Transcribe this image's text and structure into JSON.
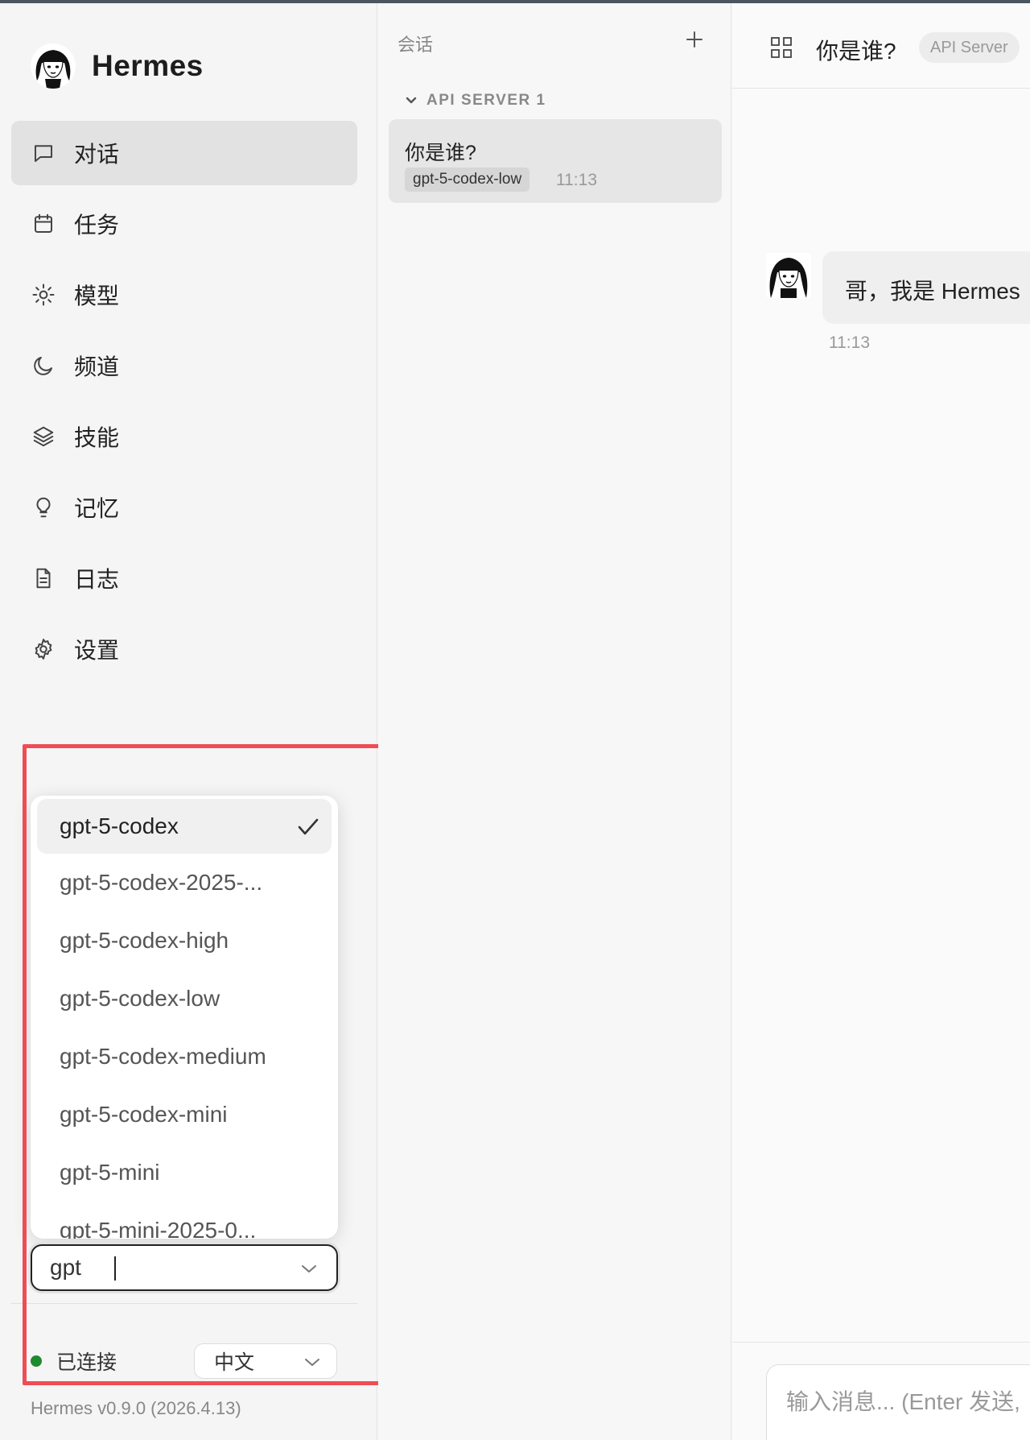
{
  "app": {
    "name": "Hermes",
    "version": "Hermes v0.9.0 (2026.4.13)"
  },
  "sidebar": {
    "items": [
      {
        "label": "对话",
        "icon": "chat-icon",
        "active": true
      },
      {
        "label": "任务",
        "icon": "calendar-icon",
        "active": false
      },
      {
        "label": "模型",
        "icon": "sun-icon",
        "active": false
      },
      {
        "label": "频道",
        "icon": "moon-icon",
        "active": false
      },
      {
        "label": "技能",
        "icon": "layers-icon",
        "active": false
      },
      {
        "label": "记忆",
        "icon": "lightbulb-icon",
        "active": false
      },
      {
        "label": "日志",
        "icon": "document-icon",
        "active": false
      },
      {
        "label": "设置",
        "icon": "gear-icon",
        "active": false
      }
    ],
    "model_dropdown": {
      "options": [
        "gpt-5-codex",
        "gpt-5-codex-2025-...",
        "gpt-5-codex-high",
        "gpt-5-codex-low",
        "gpt-5-codex-medium",
        "gpt-5-codex-mini",
        "gpt-5-mini",
        "gpt-5-mini-2025-0..."
      ],
      "selected_index": 0
    },
    "model_input": {
      "value": "gpt"
    },
    "status": {
      "label": "已连接",
      "color": "#1f8a2e"
    },
    "language": {
      "value": "中文"
    }
  },
  "sessions": {
    "title": "会话",
    "group": {
      "label": "API SERVER 1"
    },
    "items": [
      {
        "title": "你是谁?",
        "model": "gpt-5-codex-low",
        "time": "11:13"
      }
    ]
  },
  "chat": {
    "title": "你是谁?",
    "badge": "API Server",
    "messages": [
      {
        "text": "哥，我是 Hermes",
        "time": "11:13"
      }
    ],
    "composer": {
      "placeholder": "输入消息... (Enter 发送,"
    }
  },
  "highlight_color": "#ef4d55"
}
